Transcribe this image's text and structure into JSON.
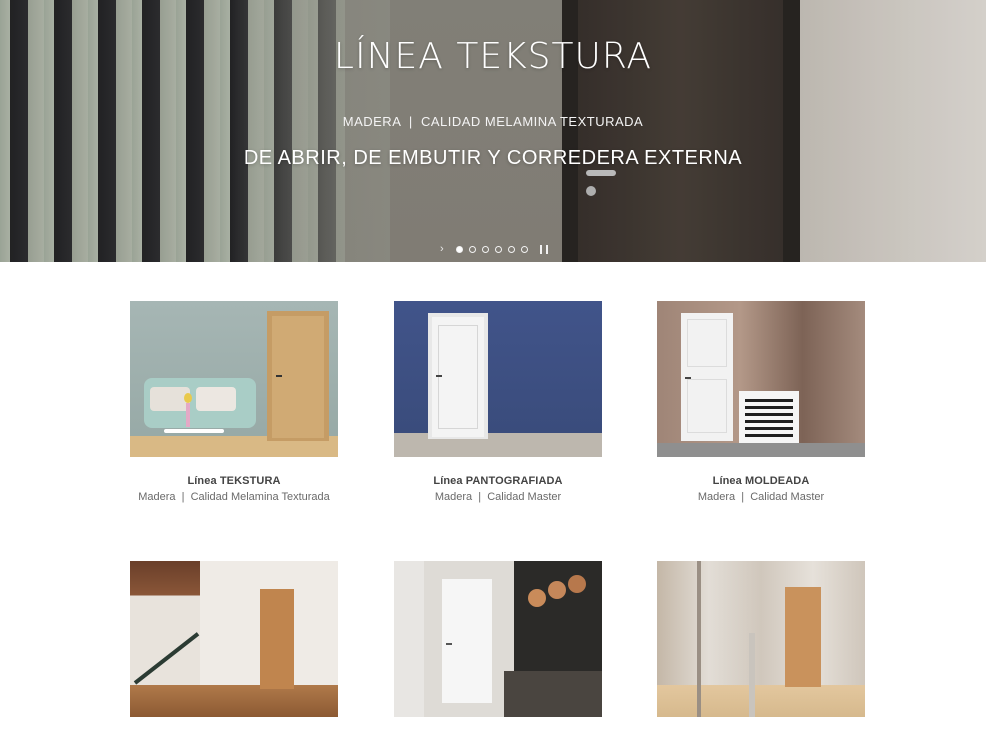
{
  "hero": {
    "title": "LÍNEA TEKSTURA",
    "subtitle": "MADERA  |  CALIDAD MELAMINA TEXTURADA",
    "tagline": "DE ABRIR, DE EMBUTIR Y CORREDERA EXTERNA",
    "slide_count": 6,
    "active_slide": 1
  },
  "products": [
    {
      "title": "Línea TEKSTURA",
      "subtitle": "Madera  |  Calidad Melamina Texturada"
    },
    {
      "title": "Línea PANTOGRAFIADA",
      "subtitle": "Madera  |  Calidad Master"
    },
    {
      "title": "Línea MOLDEADA",
      "subtitle": "Madera  |  Calidad Master"
    },
    {
      "title": "",
      "subtitle": ""
    },
    {
      "title": "",
      "subtitle": ""
    },
    {
      "title": "",
      "subtitle": ""
    }
  ],
  "colors": {
    "accent": "#444444",
    "muted": "#6a6a6a",
    "background": "#ffffff"
  }
}
